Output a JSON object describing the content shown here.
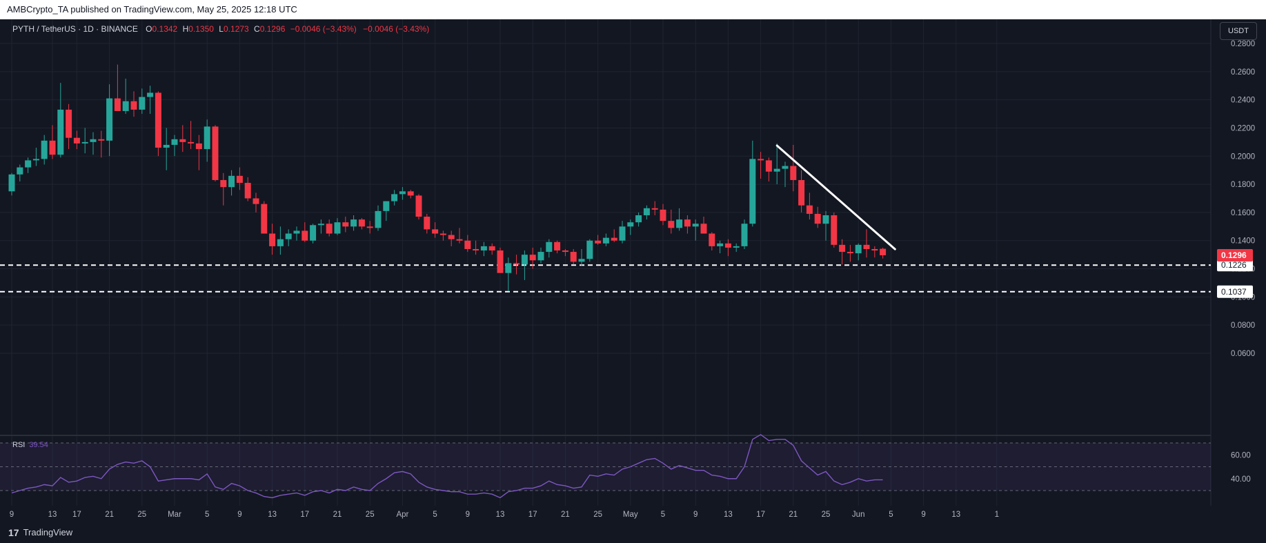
{
  "header": {
    "publisher_line": "AMBCrypto_TA published on TradingView.com, May 25, 2025 12:18 UTC"
  },
  "legend": {
    "symbol": "PYTH / TetherUS · 1D · BINANCE",
    "open_label": "O",
    "open": "0.1342",
    "high_label": "H",
    "high": "0.1350",
    "low_label": "L",
    "low": "0.1273",
    "close_label": "C",
    "close": "0.1296",
    "change": "−0.0046 (−3.43%)",
    "change2": "−0.0046 (−3.43%)"
  },
  "currency_button": "USDT",
  "rsi": {
    "label": "RSI",
    "value": "39.54"
  },
  "footer": {
    "brand": "TradingView",
    "logo": "17"
  },
  "colors": {
    "up": "#26a69a",
    "down": "#f23645",
    "background": "#131722",
    "grid": "#1f2430",
    "rsi_line": "#7e57c2",
    "trendline": "#ffffff"
  },
  "chart_data": {
    "type": "candlestick",
    "price_axis": {
      "ylim": [
        0.05,
        0.29
      ],
      "ticks": [
        "0.2800",
        "0.2600",
        "0.2400",
        "0.2200",
        "0.2000",
        "0.1800",
        "0.1600",
        "0.1400",
        "0.1200",
        "0.1000",
        "0.0800",
        "0.0600"
      ]
    },
    "x_ticks": [
      "9",
      "13",
      "17",
      "21",
      "25",
      "Mar",
      "5",
      "9",
      "13",
      "17",
      "21",
      "25",
      "Apr",
      "5",
      "9",
      "13",
      "17",
      "21",
      "25",
      "May",
      "5",
      "9",
      "13",
      "17",
      "21",
      "25",
      "Jun",
      "5",
      "9",
      "13",
      "1"
    ],
    "last_price": "0.1296",
    "levels": [
      {
        "value": 0.1226,
        "label": "0.1226"
      },
      {
        "value": 0.1037,
        "label": "0.1037"
      }
    ],
    "trendline": {
      "from": [
        0.2075
      ],
      "to": [
        0.1339
      ]
    },
    "candles": [
      [
        0.175,
        0.188,
        0.172,
        0.187
      ],
      [
        0.187,
        0.194,
        0.182,
        0.192
      ],
      [
        0.192,
        0.199,
        0.188,
        0.197
      ],
      [
        0.197,
        0.206,
        0.193,
        0.198
      ],
      [
        0.198,
        0.215,
        0.194,
        0.211
      ],
      [
        0.211,
        0.222,
        0.198,
        0.201
      ],
      [
        0.201,
        0.252,
        0.199,
        0.233
      ],
      [
        0.233,
        0.237,
        0.205,
        0.213
      ],
      [
        0.213,
        0.218,
        0.205,
        0.209
      ],
      [
        0.209,
        0.22,
        0.202,
        0.21
      ],
      [
        0.21,
        0.217,
        0.201,
        0.212
      ],
      [
        0.212,
        0.218,
        0.199,
        0.211
      ],
      [
        0.211,
        0.251,
        0.2,
        0.241
      ],
      [
        0.241,
        0.265,
        0.235,
        0.232
      ],
      [
        0.232,
        0.255,
        0.23,
        0.239
      ],
      [
        0.239,
        0.246,
        0.228,
        0.233
      ],
      [
        0.233,
        0.248,
        0.23,
        0.242
      ],
      [
        0.242,
        0.25,
        0.23,
        0.245
      ],
      [
        0.245,
        0.246,
        0.2,
        0.206
      ],
      [
        0.206,
        0.22,
        0.19,
        0.208
      ],
      [
        0.208,
        0.215,
        0.2,
        0.212
      ],
      [
        0.212,
        0.222,
        0.203,
        0.21
      ],
      [
        0.21,
        0.225,
        0.205,
        0.209
      ],
      [
        0.209,
        0.215,
        0.19,
        0.205
      ],
      [
        0.205,
        0.226,
        0.196,
        0.221
      ],
      [
        0.221,
        0.222,
        0.182,
        0.183
      ],
      [
        0.183,
        0.188,
        0.165,
        0.178
      ],
      [
        0.178,
        0.19,
        0.172,
        0.186
      ],
      [
        0.186,
        0.192,
        0.176,
        0.181
      ],
      [
        0.181,
        0.185,
        0.168,
        0.17
      ],
      [
        0.17,
        0.174,
        0.16,
        0.166
      ],
      [
        0.166,
        0.168,
        0.148,
        0.145
      ],
      [
        0.145,
        0.152,
        0.13,
        0.136
      ],
      [
        0.136,
        0.15,
        0.13,
        0.141
      ],
      [
        0.141,
        0.148,
        0.136,
        0.145
      ],
      [
        0.145,
        0.15,
        0.14,
        0.147
      ],
      [
        0.147,
        0.153,
        0.139,
        0.14
      ],
      [
        0.14,
        0.152,
        0.138,
        0.151
      ],
      [
        0.151,
        0.155,
        0.145,
        0.152
      ],
      [
        0.152,
        0.155,
        0.143,
        0.145
      ],
      [
        0.145,
        0.156,
        0.144,
        0.153
      ],
      [
        0.153,
        0.157,
        0.146,
        0.15
      ],
      [
        0.15,
        0.158,
        0.147,
        0.155
      ],
      [
        0.155,
        0.156,
        0.148,
        0.15
      ],
      [
        0.15,
        0.154,
        0.145,
        0.149
      ],
      [
        0.149,
        0.165,
        0.147,
        0.161
      ],
      [
        0.161,
        0.167,
        0.154,
        0.168
      ],
      [
        0.168,
        0.176,
        0.165,
        0.173
      ],
      [
        0.173,
        0.178,
        0.169,
        0.175
      ],
      [
        0.175,
        0.176,
        0.17,
        0.172
      ],
      [
        0.172,
        0.173,
        0.155,
        0.157
      ],
      [
        0.157,
        0.159,
        0.145,
        0.148
      ],
      [
        0.148,
        0.153,
        0.142,
        0.145
      ],
      [
        0.145,
        0.147,
        0.14,
        0.144
      ],
      [
        0.144,
        0.147,
        0.136,
        0.141
      ],
      [
        0.141,
        0.149,
        0.138,
        0.14
      ],
      [
        0.14,
        0.144,
        0.132,
        0.134
      ],
      [
        0.134,
        0.14,
        0.13,
        0.133
      ],
      [
        0.133,
        0.139,
        0.129,
        0.136
      ],
      [
        0.136,
        0.138,
        0.13,
        0.133
      ],
      [
        0.133,
        0.135,
        0.117,
        0.117
      ],
      [
        0.117,
        0.128,
        0.104,
        0.124
      ],
      [
        0.124,
        0.13,
        0.116,
        0.123
      ],
      [
        0.123,
        0.133,
        0.112,
        0.13
      ],
      [
        0.13,
        0.135,
        0.12,
        0.126
      ],
      [
        0.126,
        0.135,
        0.124,
        0.132
      ],
      [
        0.132,
        0.141,
        0.128,
        0.139
      ],
      [
        0.139,
        0.14,
        0.131,
        0.133
      ],
      [
        0.133,
        0.134,
        0.129,
        0.132
      ],
      [
        0.132,
        0.134,
        0.123,
        0.125
      ],
      [
        0.125,
        0.134,
        0.122,
        0.127
      ],
      [
        0.127,
        0.141,
        0.125,
        0.14
      ],
      [
        0.14,
        0.144,
        0.137,
        0.138
      ],
      [
        0.138,
        0.145,
        0.136,
        0.142
      ],
      [
        0.142,
        0.148,
        0.139,
        0.14
      ],
      [
        0.14,
        0.154,
        0.138,
        0.15
      ],
      [
        0.15,
        0.155,
        0.144,
        0.153
      ],
      [
        0.153,
        0.16,
        0.15,
        0.158
      ],
      [
        0.158,
        0.165,
        0.155,
        0.163
      ],
      [
        0.163,
        0.168,
        0.158,
        0.162
      ],
      [
        0.162,
        0.166,
        0.151,
        0.154
      ],
      [
        0.154,
        0.162,
        0.145,
        0.149
      ],
      [
        0.149,
        0.163,
        0.147,
        0.155
      ],
      [
        0.155,
        0.158,
        0.145,
        0.15
      ],
      [
        0.15,
        0.155,
        0.14,
        0.152
      ],
      [
        0.152,
        0.157,
        0.145,
        0.145
      ],
      [
        0.145,
        0.146,
        0.133,
        0.136
      ],
      [
        0.136,
        0.14,
        0.131,
        0.138
      ],
      [
        0.138,
        0.141,
        0.129,
        0.135
      ],
      [
        0.135,
        0.138,
        0.132,
        0.136
      ],
      [
        0.136,
        0.155,
        0.134,
        0.152
      ],
      [
        0.152,
        0.211,
        0.15,
        0.198
      ],
      [
        0.198,
        0.203,
        0.184,
        0.197
      ],
      [
        0.197,
        0.199,
        0.182,
        0.189
      ],
      [
        0.189,
        0.209,
        0.18,
        0.191
      ],
      [
        0.191,
        0.196,
        0.178,
        0.193
      ],
      [
        0.193,
        0.208,
        0.175,
        0.183
      ],
      [
        0.183,
        0.19,
        0.16,
        0.165
      ],
      [
        0.165,
        0.174,
        0.155,
        0.159
      ],
      [
        0.159,
        0.164,
        0.149,
        0.152
      ],
      [
        0.152,
        0.161,
        0.14,
        0.158
      ],
      [
        0.158,
        0.16,
        0.135,
        0.137
      ],
      [
        0.137,
        0.141,
        0.123,
        0.132
      ],
      [
        0.132,
        0.137,
        0.125,
        0.131
      ],
      [
        0.131,
        0.138,
        0.126,
        0.137
      ],
      [
        0.137,
        0.148,
        0.128,
        0.134
      ],
      [
        0.134,
        0.136,
        0.128,
        0.133
      ],
      [
        0.1342,
        0.135,
        0.1273,
        0.1296
      ]
    ],
    "rsi_axis": {
      "ticks": [
        "60.00",
        "40.00"
      ],
      "upper_band": 70,
      "lower_band": 30,
      "mid": 50
    },
    "rsi_values": [
      28,
      30,
      32,
      33,
      35,
      34,
      41,
      37,
      38,
      41,
      42,
      40,
      48,
      52,
      54,
      53,
      55,
      50,
      38,
      39,
      40,
      40,
      40,
      39,
      44,
      33,
      31,
      36,
      34,
      30,
      28,
      25,
      24,
      26,
      27,
      28,
      26,
      29,
      30,
      28,
      31,
      30,
      33,
      31,
      30,
      36,
      40,
      45,
      46,
      44,
      37,
      33,
      31,
      30,
      29,
      29,
      27,
      27,
      28,
      27,
      24,
      29,
      30,
      32,
      32,
      34,
      38,
      35,
      34,
      32,
      33,
      43,
      42,
      44,
      43,
      48,
      50,
      53,
      56,
      57,
      53,
      48,
      51,
      49,
      47,
      47,
      43,
      42,
      40,
      40,
      50,
      73,
      77,
      72,
      73,
      73,
      68,
      55,
      49,
      43,
      46,
      38,
      35,
      37,
      40,
      38,
      39,
      39
    ]
  }
}
